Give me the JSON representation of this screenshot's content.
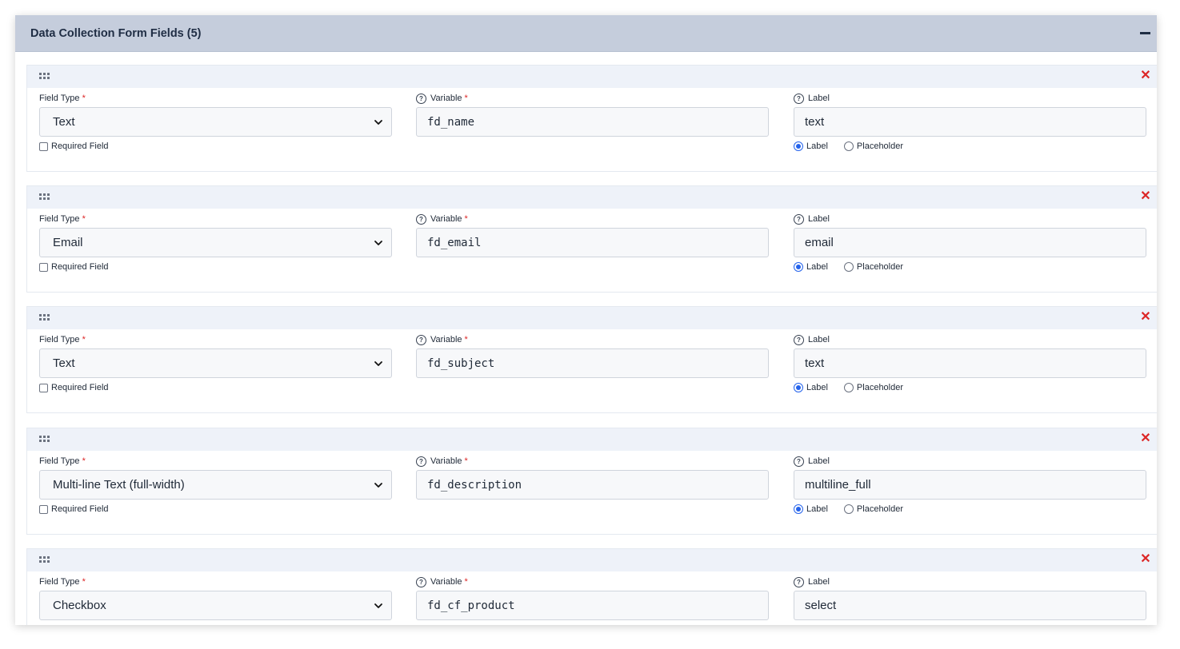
{
  "panel": {
    "title": "Data Collection Form Fields (5)"
  },
  "labels": {
    "field_type": "Field Type",
    "variable": "Variable",
    "label": "Label",
    "required_field": "Required Field",
    "radio_label": "Label",
    "radio_placeholder": "Placeholder",
    "required_marker": "*"
  },
  "fields": [
    {
      "field_type": "Text",
      "variable": "fd_name",
      "label": "text",
      "required": false,
      "display_mode": "Label"
    },
    {
      "field_type": "Email",
      "variable": "fd_email",
      "label": "email",
      "required": false,
      "display_mode": "Label"
    },
    {
      "field_type": "Text",
      "variable": "fd_subject",
      "label": "text",
      "required": false,
      "display_mode": "Label"
    },
    {
      "field_type": "Multi-line Text (full-width)",
      "variable": "fd_description",
      "label": "multiline_full",
      "required": false,
      "display_mode": "Label"
    },
    {
      "field_type": "Checkbox",
      "variable": "fd_cf_product",
      "label": "select",
      "required": false,
      "display_mode": "Label"
    }
  ],
  "colors": {
    "header_bg": "#c5cddc",
    "card_bar_bg": "#eef2f9",
    "remove": "#dc2626",
    "radio_selected": "#2563eb"
  }
}
